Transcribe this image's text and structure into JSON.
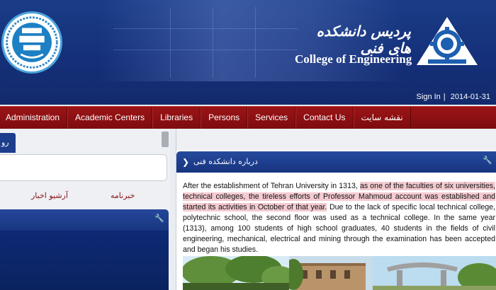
{
  "header": {
    "college_name_fa": "پردیس دانشکده های فنی",
    "college_name_en": "College of Engineering",
    "sign_in": "Sign In",
    "separator": "|",
    "date": "2014-01-31"
  },
  "nav": {
    "items": [
      {
        "label": "Administration"
      },
      {
        "label": "Academic Centers"
      },
      {
        "label": "Libraries"
      },
      {
        "label": "Persons"
      },
      {
        "label": "Services"
      },
      {
        "label": "Contact Us"
      },
      {
        "label": "نقشه سایت"
      }
    ]
  },
  "left": {
    "tab_label": "رو",
    "archive_link": "آرشیو اخبار",
    "news_link": "خبرنامه"
  },
  "main": {
    "panel_title": "درباره دانشکده فنی",
    "paragraph": {
      "part1": "After the establishment of Tehran University in 1313, ",
      "part2": "as one of the faculties of six universities, technical colleges, the tireless efforts of Professor Mahmoud account was established and started its activities in October of that year.",
      "part3": " Due to the lack of specific local technical college, polytechnic school, the second floor was used as a technical college. In the same year (1313), among 100 students of high school graduates, 40 students in the fields of civil engineering, mechanical, electrical and mining through the examination has been accepted and began his studies."
    }
  },
  "colors": {
    "header_blue": "#1a3c86",
    "nav_red": "#9c1416",
    "panel_blue": "#264a9e",
    "highlight": "#eba0aa"
  }
}
